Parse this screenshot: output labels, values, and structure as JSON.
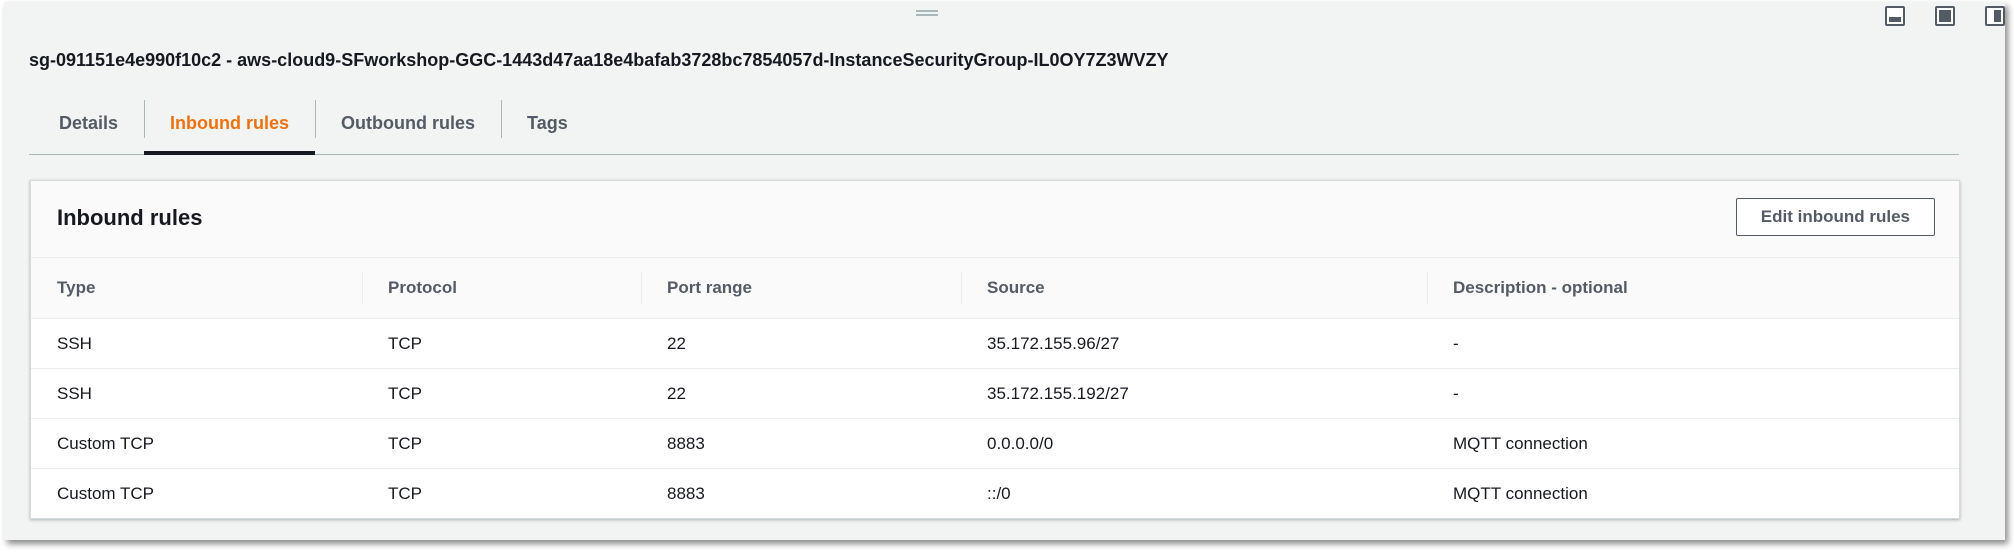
{
  "security_group": {
    "title": "sg-091151e4e990f10c2 - aws-cloud9-SFworkshop-GGC-1443d47aa18e4bafab3728bc7854057d-InstanceSecurityGroup-IL0OY7Z3WVZY"
  },
  "tabs": [
    {
      "label": "Details",
      "active": false
    },
    {
      "label": "Inbound rules",
      "active": true
    },
    {
      "label": "Outbound rules",
      "active": false
    },
    {
      "label": "Tags",
      "active": false
    }
  ],
  "panel": {
    "title": "Inbound rules",
    "edit_button_label": "Edit inbound rules"
  },
  "table": {
    "columns": [
      "Type",
      "Protocol",
      "Port range",
      "Source",
      "Description - optional"
    ],
    "rows": [
      [
        "SSH",
        "TCP",
        "22",
        "35.172.155.96/27",
        "-"
      ],
      [
        "SSH",
        "TCP",
        "22",
        "35.172.155.192/27",
        "-"
      ],
      [
        "Custom TCP",
        "TCP",
        "8883",
        "0.0.0.0/0",
        "MQTT connection"
      ],
      [
        "Custom TCP",
        "TCP",
        "8883",
        "::/0",
        "MQTT connection"
      ]
    ]
  },
  "window_controls": {
    "icons": [
      "minimize-panel-icon",
      "maximize-panel-icon",
      "side-panel-icon"
    ]
  },
  "colors": {
    "accent": "#ec7211",
    "tab_text": "#545b64",
    "text": "#16191f",
    "background": "#f2f3f3"
  }
}
